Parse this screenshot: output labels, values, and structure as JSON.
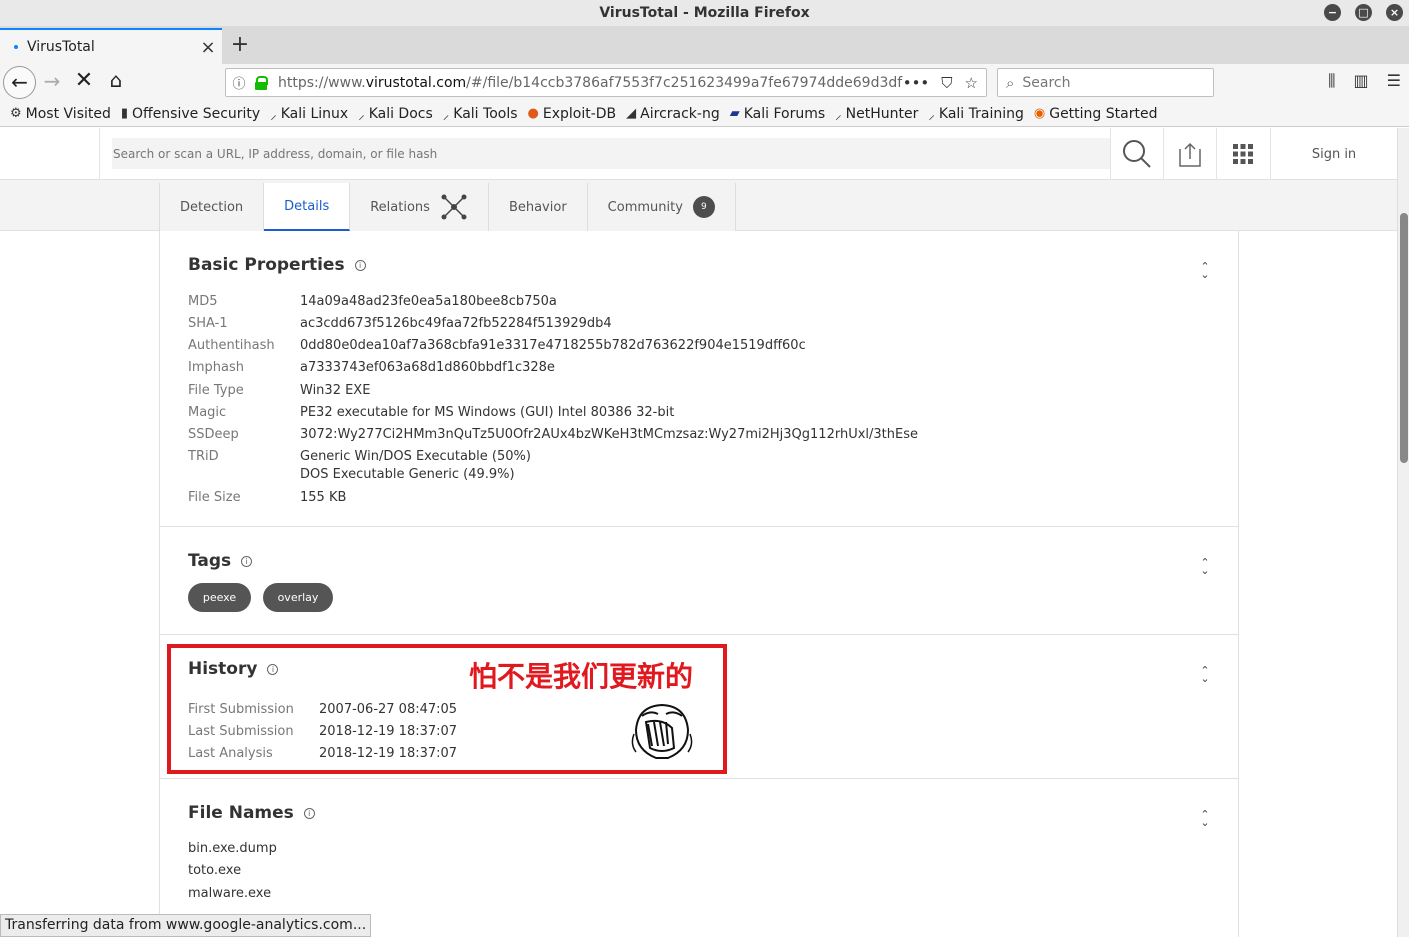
{
  "window": {
    "title": "VirusTotal - Mozilla Firefox"
  },
  "tab": {
    "title": "VirusTotal"
  },
  "navbar": {
    "url_prefix": "https://www.",
    "url_domain": "virustotal.com",
    "url_rest": "/#/file/b14ccb3786af7553f7c251623499a7fe67974dde69d3df",
    "search_placeholder": "Search"
  },
  "bookmarks": [
    {
      "label": "Most Visited",
      "icon": "gear-icon"
    },
    {
      "label": "Offensive Security",
      "icon": "offsec-icon"
    },
    {
      "label": "Kali Linux",
      "icon": "kali-icon"
    },
    {
      "label": "Kali Docs",
      "icon": "kali-icon"
    },
    {
      "label": "Kali Tools",
      "icon": "kali-icon"
    },
    {
      "label": "Exploit-DB",
      "icon": "exploitdb-icon"
    },
    {
      "label": "Aircrack-ng",
      "icon": "aircrack-icon"
    },
    {
      "label": "Kali Forums",
      "icon": "forums-icon"
    },
    {
      "label": "NetHunter",
      "icon": "kali-icon"
    },
    {
      "label": "Kali Training",
      "icon": "kali-icon"
    },
    {
      "label": "Getting Started",
      "icon": "firefox-icon"
    }
  ],
  "vt": {
    "search_placeholder": "Search or scan a URL, IP address, domain, or file hash",
    "signin": "Sign in",
    "tabs": [
      "Detection",
      "Details",
      "Relations",
      "Behavior",
      "Community"
    ],
    "community_count": "9"
  },
  "basic": {
    "title": "Basic Properties",
    "rows": [
      {
        "k": "MD5",
        "v": "14a09a48ad23fe0ea5a180bee8cb750a"
      },
      {
        "k": "SHA-1",
        "v": "ac3cdd673f5126bc49faa72fb52284f513929db4"
      },
      {
        "k": "Authentihash",
        "v": "0dd80e0dea10af7a368cbfa91e3317e4718255b782d763622f904e1519dff60c"
      },
      {
        "k": "Imphash",
        "v": "a7333743ef063a68d1d860bbdf1c328e"
      },
      {
        "k": "File Type",
        "v": "Win32 EXE"
      },
      {
        "k": "Magic",
        "v": "PE32 executable for MS Windows (GUI) Intel 80386 32-bit"
      },
      {
        "k": "SSDeep",
        "v": "3072:Wy277Ci2HMm3nQuTz5U0Ofr2AUx4bzWKeH3tMCmzsaz:Wy27mi2Hj3Qg112rhUxl/3thEse"
      },
      {
        "k": "TRiD",
        "v": "Generic Win/DOS Executable (50%)",
        "v2": "DOS Executable Generic (49.9%)"
      },
      {
        "k": "File Size",
        "v": "155 KB"
      }
    ]
  },
  "tags": {
    "title": "Tags",
    "items": [
      "peexe",
      "overlay"
    ]
  },
  "history": {
    "title": "History",
    "rows": [
      {
        "k": "First Submission",
        "v": "2007-06-27 08:47:05"
      },
      {
        "k": "Last Submission",
        "v": "2018-12-19 18:37:07"
      },
      {
        "k": "Last Analysis",
        "v": "2018-12-19 18:37:07"
      }
    ],
    "annotation": "怕不是我们更新的"
  },
  "filenames": {
    "title": "File Names",
    "items": [
      "bin.exe.dump",
      "toto.exe",
      "malware.exe"
    ]
  },
  "status": "Transferring data from www.google-analytics.com..."
}
